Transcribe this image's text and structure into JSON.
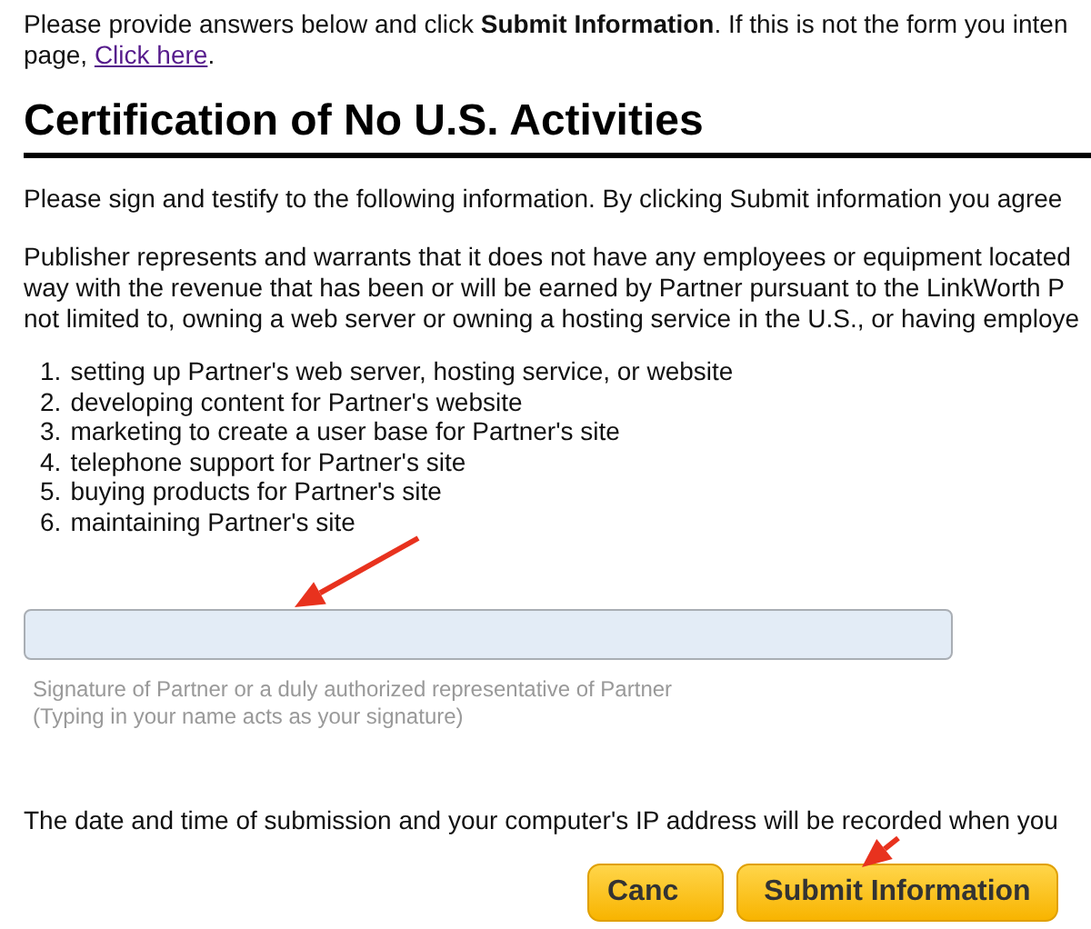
{
  "intro": {
    "line_1": "Please provide answers below and click **Submit Information**. If this is not the form you inten",
    "line_2": "page,",
    "link": "Click here",
    "line_2_end": "."
  },
  "heading": "Certification of No U.S. Activities",
  "agreement": "Please sign and testify to the following information. By clicking Submit information you agree",
  "statement_lines": [
    "Publisher represents and warrants that it does not have any employees or equipment located",
    "way with the revenue that has been or will be earned by Partner pursuant to the LinkWorth P",
    "not limited to, owning a web server or owning a hosting service in the U.S., or having employe"
  ],
  "activities": [
    {
      "number": "1.",
      "text": "setting up Partner's web server, hosting service, or website"
    },
    {
      "number": "2.",
      "text": "developing content for Partner's website"
    },
    {
      "number": "3.",
      "text": "marketing to create a user base for Partner's site"
    },
    {
      "number": "4.",
      "text": "telephone support for Partner's site"
    },
    {
      "number": "5.",
      "text": "buying products for Partner's site"
    },
    {
      "number": "6.",
      "text": "maintaining Partner's site"
    }
  ],
  "signature": {
    "caption": [
      "Signature of Partner or a duly authorized representative of Partner",
      "(Typing in your name acts as your signature)"
    ]
  },
  "notice": "The date and time of submission and your computer's IP address will be recorded when you",
  "buttons": [
    {
      "kind": "cancel",
      "label": "Canc"
    },
    {
      "kind": "submit",
      "label": "Submit Information"
    }
  ]
}
